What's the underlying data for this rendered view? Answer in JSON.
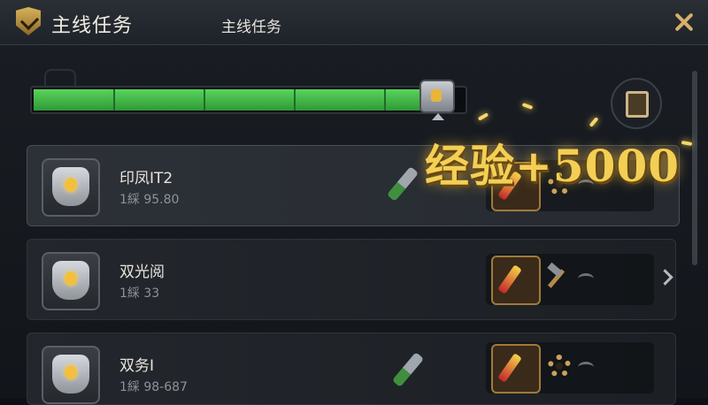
{
  "window": {
    "title": "主线任务"
  },
  "progress": {
    "label": "主线任务",
    "fill_fraction": 0.98,
    "segments": 5
  },
  "popup": {
    "text": "经验+5000"
  },
  "quests": [
    {
      "name": "印凤IT2",
      "subtitle": "1綵 95.80"
    },
    {
      "name": "双光阅",
      "subtitle": "1綵 33"
    },
    {
      "name": "双务I",
      "subtitle": "1綵 98-687"
    }
  ],
  "colors": {
    "accent": "#d6b06a",
    "progress": "#3fbf45",
    "popup": "#f3cf55"
  }
}
